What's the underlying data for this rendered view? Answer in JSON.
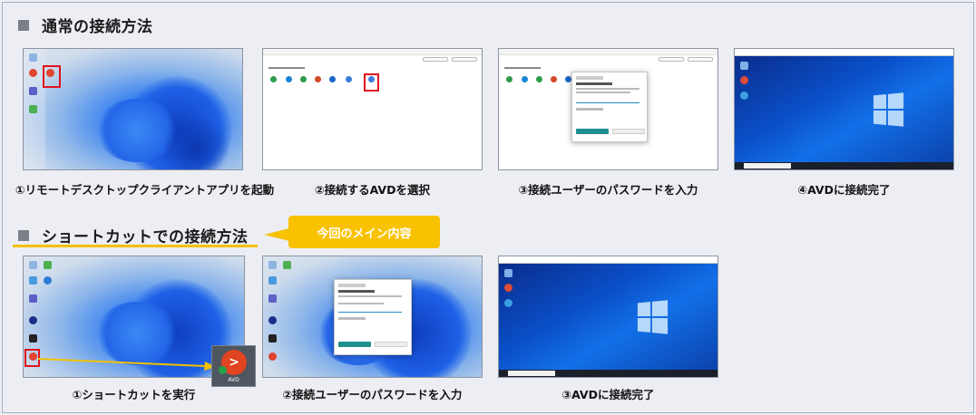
{
  "sections": {
    "normal_title": "通常の接続方法",
    "shortcut_title": "ショートカットでの接続方法",
    "callout": "今回のメイン内容"
  },
  "captions": {
    "normal": [
      "①リモートデスクトップクライアントアプリを起動",
      "②接続するAVDを選択",
      "③接続ユーザーのパスワードを入力",
      "④AVDに接続完了"
    ],
    "shortcut": [
      "①ショートカットを実行",
      "②接続ユーザーのパスワードを入力",
      "③AVDに接続完了"
    ]
  },
  "shortcut_icon_label": "AVD",
  "colors": {
    "accent_yellow": "#f8c200",
    "highlight_red": "#e0141c",
    "win10_blue": "#0a4fc8"
  }
}
